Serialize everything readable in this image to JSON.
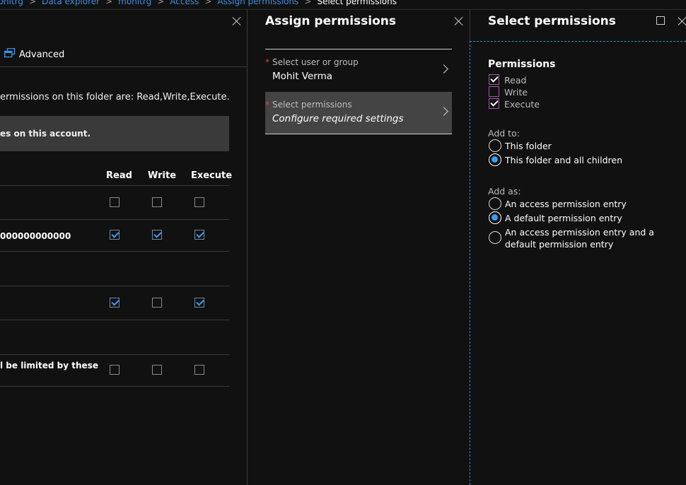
{
  "breadcrumb": {
    "items": [
      "monitrg",
      "Data explorer",
      "monitrg",
      "Access",
      "Assign permissions",
      "Select permissions"
    ]
  },
  "access_panel": {
    "advanced_label": "Advanced",
    "info_text": "ermissions on this folder are: Read,Write,Execute.",
    "banner_text": "es on this account.",
    "columns": [
      "Read",
      "Write",
      "Execute"
    ],
    "rows": [
      {
        "label": "",
        "read": false,
        "write": false,
        "execute": false
      },
      {
        "label": "000000000000",
        "read": true,
        "write": true,
        "execute": true
      },
      {
        "label": "",
        "read": true,
        "write": false,
        "execute": true
      },
      {
        "label": "l be limited by these",
        "read": false,
        "write": false,
        "execute": false
      }
    ]
  },
  "assign_panel": {
    "title": "Assign permissions",
    "user_field": {
      "required_mark": "*",
      "label": "Select user or group",
      "value": "Mohit Verma"
    },
    "perm_field": {
      "required_mark": "*",
      "label": "Select permissions",
      "value": "Configure required settings"
    }
  },
  "select_panel": {
    "title": "Select permissions",
    "permissions_heading": "Permissions",
    "permissions": [
      {
        "label": "Read",
        "checked": true
      },
      {
        "label": "Write",
        "checked": false
      },
      {
        "label": "Execute",
        "checked": true
      }
    ],
    "add_to_label": "Add to:",
    "add_to_options": [
      {
        "label": "This folder",
        "selected": false
      },
      {
        "label": "This folder and all children",
        "selected": true
      }
    ],
    "add_as_label": "Add as:",
    "add_as_options": [
      {
        "label": "An access permission entry",
        "selected": false
      },
      {
        "label": "A default permission entry",
        "selected": true
      },
      {
        "label_line1": "An access permission entry and a",
        "label_line2": "default permission entry",
        "selected": false
      }
    ]
  },
  "colors": {
    "background": "#111111",
    "accent_blue": "#3d9df3",
    "link_blue": "#3d8fe0",
    "selected_row": "#444444",
    "banner": "#3a3a3a",
    "required_red": "#e0403b",
    "focus_dashed": "#2b8fc7",
    "checkbox_border_purple": "#a15aa8"
  }
}
